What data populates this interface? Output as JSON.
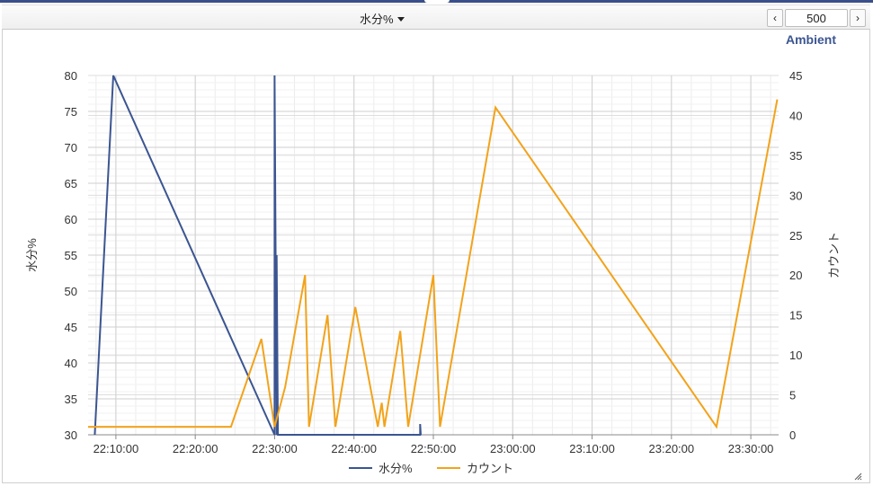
{
  "toolbar": {
    "series_select_label": "水分%",
    "prev_label": "‹",
    "next_label": "›",
    "count_value": "500"
  },
  "chart_data": {
    "type": "line",
    "title": "Ambient",
    "x_tick_labels": [
      "22:10:00",
      "22:20:00",
      "22:30:00",
      "22:40:00",
      "22:50:00",
      "23:00:00",
      "23:10:00",
      "23:20:00",
      "23:30:00"
    ],
    "x_tick_minutes": [
      10,
      20,
      30,
      40,
      50,
      60,
      70,
      80,
      90
    ],
    "xlim_minutes": [
      6.5,
      93.5
    ],
    "ylabel_left": "水分%",
    "ylabel_right": "カウント",
    "ylim_left": [
      30,
      80
    ],
    "ylim_right": [
      0,
      45
    ],
    "y_left_ticks": [
      30,
      35,
      40,
      45,
      50,
      55,
      60,
      65,
      70,
      75,
      80
    ],
    "y_right_ticks": [
      0,
      5,
      10,
      15,
      20,
      25,
      30,
      35,
      40,
      45
    ],
    "grid": true,
    "legend_position": "bottom-center",
    "series": [
      {
        "name": "水分%",
        "axis": "left",
        "color": "#3b5591",
        "points": [
          {
            "time": "22:07:20",
            "value": 30
          },
          {
            "time": "22:09:40",
            "value": 80
          },
          {
            "time": "22:30:00",
            "value": 30
          },
          {
            "time": "22:30:00",
            "value": 80
          },
          {
            "time": "22:30:15",
            "value": 30
          },
          {
            "time": "22:30:15",
            "value": 55
          },
          {
            "time": "22:30:25",
            "value": 30
          },
          {
            "time": "22:48:20",
            "value": 30
          },
          {
            "time": "22:48:20",
            "value": 31.5
          },
          {
            "time": "22:48:25",
            "value": 30
          }
        ]
      },
      {
        "name": "カウント",
        "axis": "right",
        "color": "#f2a31b",
        "points": [
          {
            "time": "22:06:30",
            "value": 1
          },
          {
            "time": "22:24:30",
            "value": 1
          },
          {
            "time": "22:28:20",
            "value": 12
          },
          {
            "time": "22:30:00",
            "value": 1
          },
          {
            "time": "22:31:20",
            "value": 6
          },
          {
            "time": "22:33:50",
            "value": 20
          },
          {
            "time": "22:34:20",
            "value": 1
          },
          {
            "time": "22:36:40",
            "value": 15
          },
          {
            "time": "22:37:40",
            "value": 1
          },
          {
            "time": "22:40:10",
            "value": 16
          },
          {
            "time": "22:43:00",
            "value": 1
          },
          {
            "time": "22:43:30",
            "value": 4
          },
          {
            "time": "22:43:50",
            "value": 1
          },
          {
            "time": "22:45:50",
            "value": 13
          },
          {
            "time": "22:46:50",
            "value": 1
          },
          {
            "time": "22:50:00",
            "value": 20
          },
          {
            "time": "22:50:50",
            "value": 1
          },
          {
            "time": "22:57:50",
            "value": 41
          },
          {
            "time": "23:25:40",
            "value": 1
          },
          {
            "time": "23:33:20",
            "value": 42
          }
        ]
      }
    ]
  }
}
